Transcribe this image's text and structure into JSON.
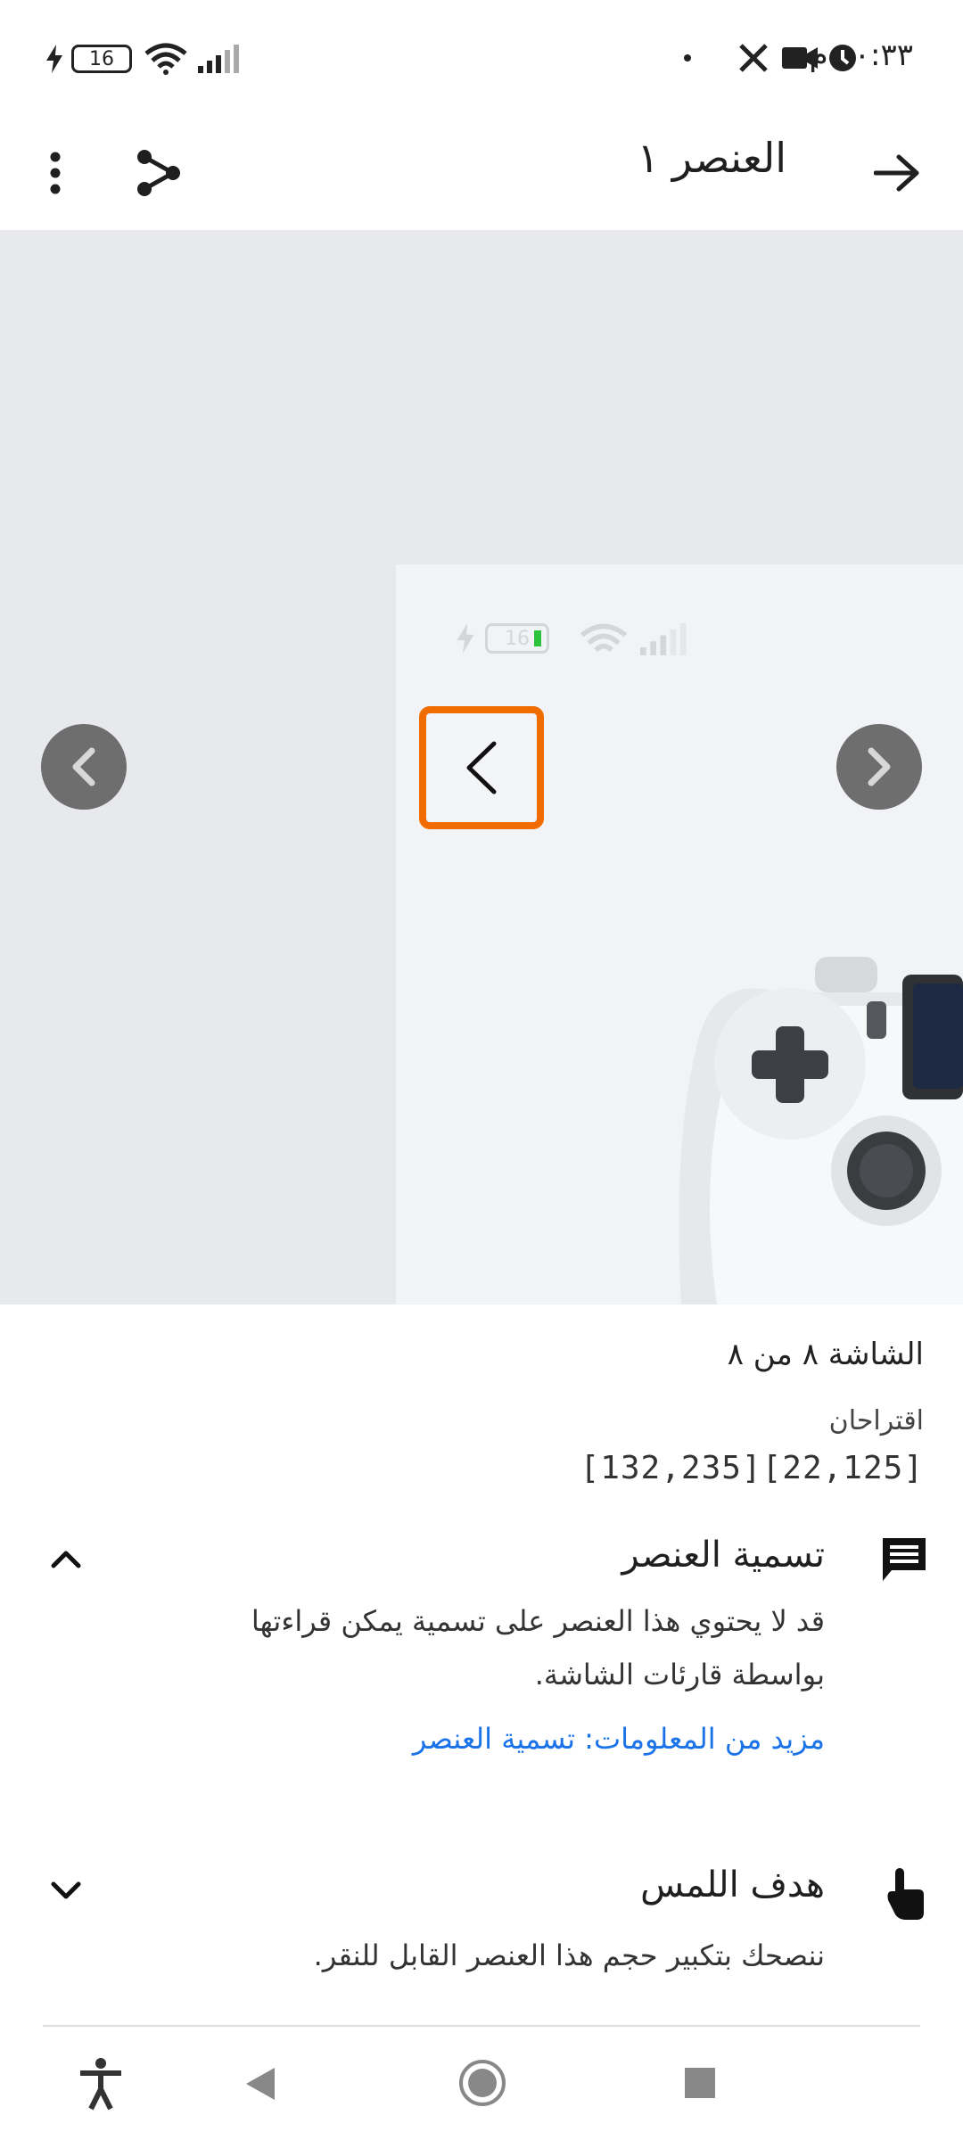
{
  "status_bar": {
    "time": "١٠:٣٣ م",
    "battery": "16"
  },
  "app_bar": {
    "title": "العنصر ١",
    "icons": [
      "back-arrow-icon",
      "share-icon",
      "more-vert-icon"
    ]
  },
  "preview": {
    "thumb_battery": "16",
    "icons": [
      "chevron-left-icon",
      "chevron-right-icon"
    ]
  },
  "details": {
    "screen_count": "الشاشة ٨ من ٨",
    "suggestions_label": "اقتراحان",
    "coords": "[132,235][22,125]",
    "sections": [
      {
        "title": "تسمية العنصر",
        "icon": "comment-icon",
        "text_line1": "قد لا يحتوي هذا العنصر على تسمية يمكن قراءتها",
        "text_line2": "بواسطة قارئات الشاشة.",
        "link": "مزيد من المعلومات: تسمية العنصر",
        "expanded": true
      },
      {
        "title": "هدف اللمس",
        "icon": "touch-icon",
        "text_line1": "ننصحك بتكبير حجم هذا العنصر القابل للنقر.",
        "expanded": false
      }
    ]
  },
  "bottom_nav": {
    "icons": [
      "accessibility-icon",
      "back-triangle-icon",
      "home-circle-icon",
      "recents-square-icon"
    ]
  }
}
